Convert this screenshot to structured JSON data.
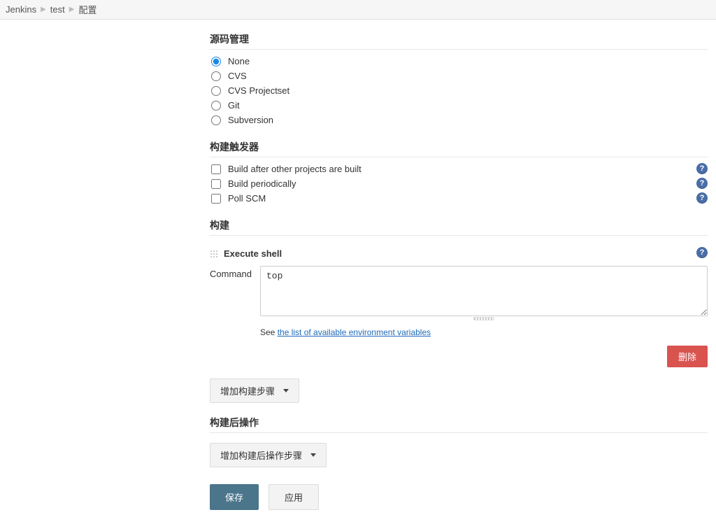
{
  "breadcrumb": {
    "items": [
      "Jenkins",
      "test",
      "配置"
    ]
  },
  "scm": {
    "title": "源码管理",
    "options": {
      "none": "None",
      "cvs": "CVS",
      "cvsp": "CVS Projectset",
      "git": "Git",
      "svn": "Subversion"
    },
    "selected": "none"
  },
  "triggers": {
    "title": "构建触发器",
    "items": {
      "after_other": "Build after other projects are built",
      "periodic": "Build periodically",
      "poll_scm": "Poll SCM"
    }
  },
  "build": {
    "title": "构建",
    "step_title": "Execute shell",
    "command_label": "Command",
    "command_value": "top",
    "env_prefix": "See ",
    "env_link": "the list of available environment variables",
    "delete_label": "删除",
    "add_step_label": "增加构建步骤"
  },
  "post_build": {
    "title": "构建后操作",
    "add_label": "增加构建后操作步骤"
  },
  "buttons": {
    "save": "保存",
    "apply": "应用"
  },
  "help_glyph": "?"
}
